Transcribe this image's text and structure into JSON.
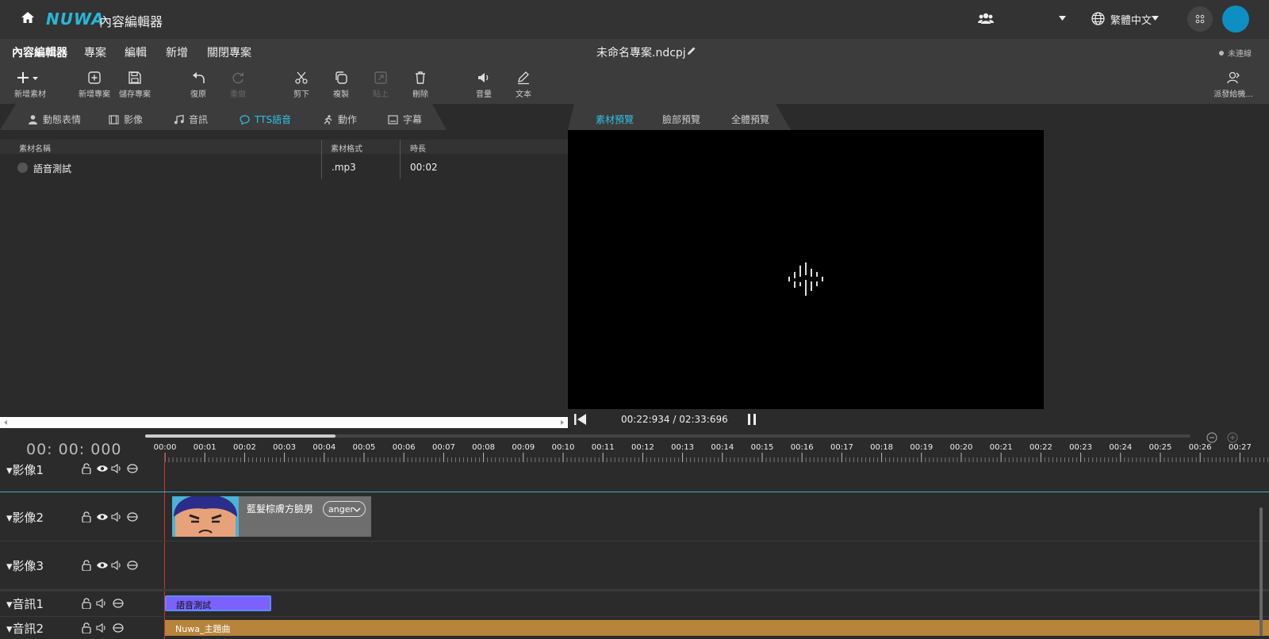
{
  "app": {
    "brand": "NUWA",
    "title": "內容編輯器",
    "language": "繁體中文"
  },
  "menu": {
    "items": [
      "內容編輯器",
      "專案",
      "編輯",
      "新增",
      "關閉專案"
    ],
    "project_name": "未命名專案.ndcpj",
    "connection": "未連線"
  },
  "toolbar": {
    "tools": [
      {
        "label": "新增素材",
        "icon": "plus-icon"
      },
      {
        "label": "新增專案",
        "icon": "new-file-icon"
      },
      {
        "label": "儲存專案",
        "icon": "save-icon"
      },
      {
        "label": "復原",
        "icon": "undo-icon"
      },
      {
        "label": "重做",
        "icon": "redo-icon"
      },
      {
        "label": "剪下",
        "icon": "scissors-icon"
      },
      {
        "label": "複製",
        "icon": "copy-icon"
      },
      {
        "label": "貼上",
        "icon": "paste-icon"
      },
      {
        "label": "刪除",
        "icon": "trash-icon"
      },
      {
        "label": "音量",
        "icon": "volume-icon"
      },
      {
        "label": "文本",
        "icon": "pen-icon"
      },
      {
        "label": "派發給機...",
        "icon": "dispatch-icon"
      }
    ]
  },
  "asset_tabs": {
    "tabs": [
      "動態表情",
      "影像",
      "音訊",
      "TTS語音",
      "動作",
      "字幕"
    ],
    "active": "TTS語音"
  },
  "asset_table": {
    "columns": [
      "素材名稱",
      "素材格式",
      "時長"
    ],
    "rows": [
      {
        "name": "語音測試",
        "format": ".mp3",
        "duration": "00:02"
      }
    ]
  },
  "preview_tabs": {
    "tabs": [
      "素材預覽",
      "臉部預覽",
      "全體預覽"
    ],
    "active": "素材預覽"
  },
  "player": {
    "time": "00:22:934 / 02:33:696"
  },
  "timeline": {
    "timecode": "00: 00: 000",
    "ruler": [
      "00:00",
      "00:01",
      "00:02",
      "00:03",
      "00:04",
      "00:05",
      "00:06",
      "00:07",
      "00:08",
      "00:09",
      "00:10",
      "00:11",
      "00:12",
      "00:13",
      "00:14",
      "00:15",
      "00:16",
      "00:17",
      "00:18",
      "00:19",
      "00:20",
      "00:21",
      "00:22",
      "00:23",
      "00:24",
      "00:25",
      "00:26",
      "00:27"
    ],
    "tracks": [
      {
        "name": "影像1"
      },
      {
        "name": "影像2"
      },
      {
        "name": "影像3"
      },
      {
        "name": "音訊1"
      },
      {
        "name": "音訊2"
      }
    ],
    "clips": {
      "face_clip": {
        "name": "藍髮棕膚方臉男",
        "emotion": "anger"
      },
      "tts_clip": {
        "name": "語音測試"
      },
      "music_clip": {
        "name": "Nuwa_主題曲"
      }
    }
  },
  "colors": {
    "accent": "#2fc1e6",
    "avatar": "#0e8fc4",
    "tts_clip": "#7b61ff",
    "music_clip": "#b8843c",
    "playhead": "#d32f2f"
  }
}
